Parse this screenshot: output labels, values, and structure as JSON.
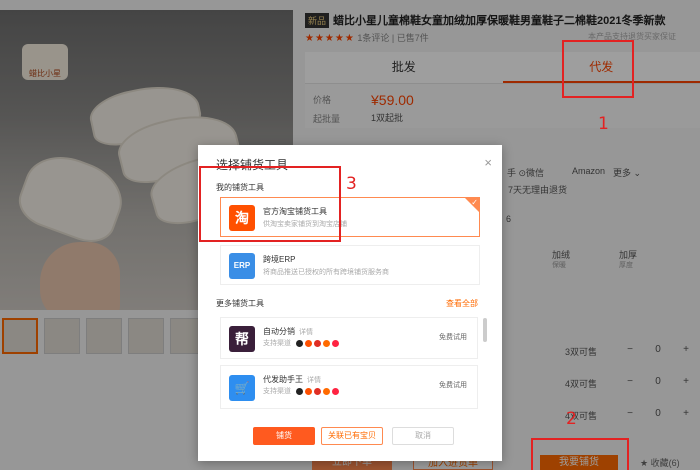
{
  "product": {
    "new_badge": "新品",
    "title": "蜡比小星儿童棉鞋女童加绒加厚保暖鞋男童鞋子二棉鞋2021冬季新款",
    "stars": "★★★★★",
    "reviews": "1条评论",
    "sold": "已售7件",
    "right_note": "本产品支持退货买家保证",
    "logo_text": "蜡比小星"
  },
  "tabs": {
    "wholesale": "批发",
    "dropship": "代发"
  },
  "info": {
    "price_label": "价格",
    "price": "¥59.00",
    "min_label": "起批量",
    "min_value": "1双起批"
  },
  "peek": {
    "share_wechat": "手  ⊙微信",
    "share_amazon": "Amazon",
    "more": "更多 ⌄",
    "return_note": "7天无理由退货",
    "col1": "加绒",
    "col1_sub": "保暖",
    "col2": "加厚",
    "col2_sub": "厚度",
    "num6": "6"
  },
  "stock_rows": [
    {
      "avail": "3双可售",
      "qty": "0"
    },
    {
      "avail": "4双可售",
      "qty": "0"
    },
    {
      "avail": "4双可售",
      "qty": "0"
    }
  ],
  "bottom": {
    "order": "立即下单",
    "cart": "加入进货单",
    "dropship_btn": "我要铺货",
    "fav": "收藏(6)"
  },
  "modal": {
    "title": "选择铺货工具",
    "close": "×",
    "my_tools_label": "我的铺货工具",
    "more_tools_label": "更多铺货工具",
    "view_all": "查看全部",
    "my_tools": [
      {
        "icon": "淘",
        "name": "官方淘宝铺货工具",
        "desc": "供淘宝卖家铺货到淘宝店铺",
        "color": "#ff5000"
      },
      {
        "icon": "ERP",
        "name": "跨境ERP",
        "desc": "将商品推送已授权的所有跨境铺货服务商",
        "color": "#3a8ee6"
      }
    ],
    "more_tools": [
      {
        "icon": "帮",
        "name": "自动分销",
        "tag": "详情",
        "src": "支持渠道",
        "trial": "免费试用",
        "color": "#3a1f3a"
      },
      {
        "icon": "🛒",
        "name": "代发助手王",
        "tag": "详情",
        "src": "支持渠道",
        "trial": "免费试用",
        "color": "#2e8ef0"
      }
    ],
    "btn_ok": "铺货",
    "btn_related": "关联已有宝贝",
    "btn_cancel": "取消"
  },
  "annotations": {
    "n1": "1",
    "n2": "2",
    "n3": "3",
    "color": "#e32222"
  }
}
